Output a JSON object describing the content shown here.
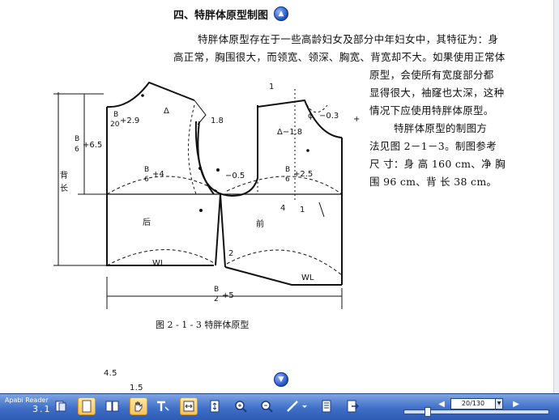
{
  "document": {
    "heading": "四、特胖体原型制图",
    "paragraph_lines": [
      "特胖体原型存在于一些高龄妇女及部分中年妇女中，其特征为：身",
      "高正常，胸围很大，而领宽、领深、胸宽、背宽却不大。如果使用正常体",
      "原型，会使所有宽度部分都",
      "显得很大，袖窿也太深，这种",
      "情况下应使用特胖体原型。",
      "特胖体原型的制图方",
      "法见图 2－1－3。制图参考",
      "尺 寸：身 高 160 cm、净 胸",
      "围 96 cm、背 长 38 cm。"
    ],
    "figure_caption": "图 2 - 1 - 3    特胖体原型",
    "figure_labels": {
      "back_length_1": "背",
      "back_length_2": "长",
      "b6_65": "+6.5",
      "b6_4": "+4",
      "b6_25": "+2.5",
      "b20_29": "+2.9",
      "b2_5": "+5",
      "b_num": "B",
      "den6": "6",
      "den20": "20",
      "den2": "2",
      "v18": "1.8",
      "vneg18": "Δ−1.8",
      "vneg05": "−0.5",
      "vneg03": "−0.3",
      "vplus1": "+1",
      "phi": "ϕ",
      "one_top": "1",
      "four": "4",
      "one_right": "1",
      "two": "2",
      "back_label": "后",
      "front_label": "前",
      "wl_left": "WL",
      "wl_right": "WL",
      "delta": "Δ",
      "small_o": "○"
    },
    "next_figure_labels": {
      "a": "4.5",
      "b": "1.5"
    }
  },
  "toolbar": {
    "app_name": "Apabi Reader",
    "version": "3.1",
    "buttons": [
      "page-thumbnails",
      "single-page-view",
      "two-page-view",
      "hand-tool",
      "text-select-tool",
      "fit-width",
      "fit-page",
      "zoom-in",
      "zoom-out",
      "pen-annotation",
      "annotation-dropdown",
      "bookmark",
      "export"
    ],
    "page_indicator": "20/130"
  },
  "colors": {
    "toolbar_top": "#7fa4e3",
    "toolbar_bottom": "#2e5bb3",
    "active_button": "#f6c35a",
    "nav_icon": "#1f4fbf"
  }
}
